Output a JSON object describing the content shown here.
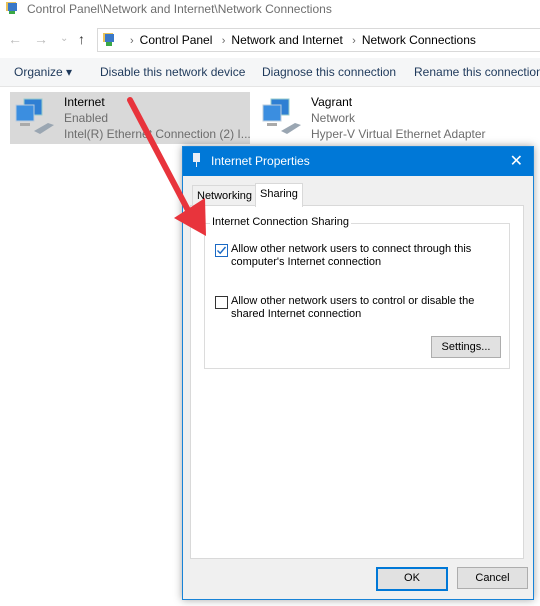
{
  "window": {
    "title": "Control Panel\\Network and Internet\\Network Connections"
  },
  "address_bar": {
    "crumbs": [
      "Control Panel",
      "Network and Internet",
      "Network Connections"
    ]
  },
  "nav": {
    "back": "←",
    "forward": "→",
    "recent": "⌄",
    "up": "↑"
  },
  "toolbar": {
    "organize": "Organize ▾",
    "disable": "Disable this network device",
    "diagnose": "Diagnose this connection",
    "rename": "Rename this connection"
  },
  "connections": [
    {
      "name": "Internet",
      "status": "Enabled",
      "device": "Intel(R) Ethernet Connection (2) I...",
      "selected": true
    },
    {
      "name": "Vagrant",
      "status": "Network",
      "device": "Hyper-V Virtual Ethernet Adapter",
      "selected": false
    }
  ],
  "dialog": {
    "title": "Internet Properties",
    "close": "✕",
    "tabs": [
      "Networking",
      "Sharing"
    ],
    "active_tab": "Sharing",
    "group_title": "Internet Connection Sharing",
    "options": [
      {
        "label": "Allow other network users to connect through this computer's Internet connection",
        "checked": true
      },
      {
        "label": "Allow other network users to control or disable the shared Internet connection",
        "checked": false
      }
    ],
    "settings_button": "Settings...",
    "ok_button": "OK",
    "cancel_button": "Cancel"
  },
  "colors": {
    "accent": "#0078d7",
    "arrow": "#e8343c"
  }
}
